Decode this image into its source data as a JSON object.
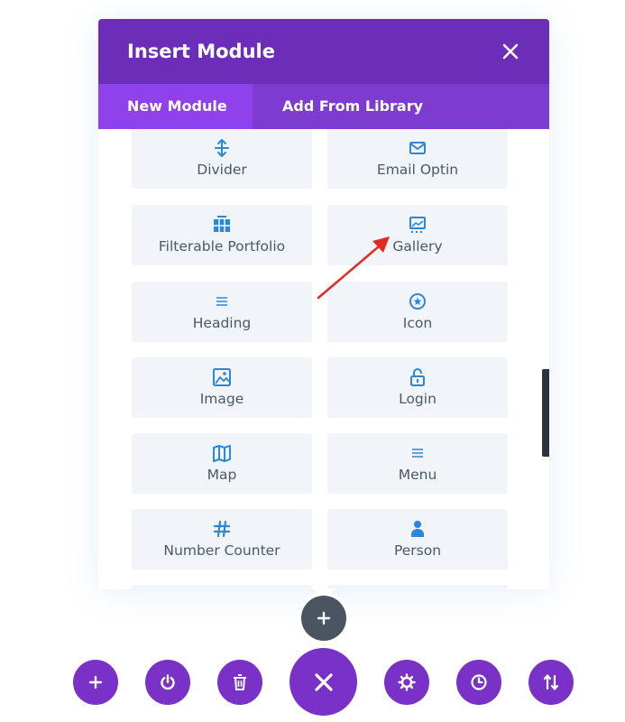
{
  "modal": {
    "title": "Insert Module",
    "tabs": [
      {
        "label": "New Module",
        "active": true
      },
      {
        "label": "Add From Library",
        "active": false
      }
    ]
  },
  "modules": [
    {
      "label": "Divider",
      "icon": "divider-icon"
    },
    {
      "label": "Email Optin",
      "icon": "email-icon"
    },
    {
      "label": "Filterable Portfolio",
      "icon": "portfolio-grid-icon"
    },
    {
      "label": "Gallery",
      "icon": "gallery-icon"
    },
    {
      "label": "Heading",
      "icon": "heading-lines-icon"
    },
    {
      "label": "Icon",
      "icon": "star-circle-icon"
    },
    {
      "label": "Image",
      "icon": "image-icon"
    },
    {
      "label": "Login",
      "icon": "unlock-icon"
    },
    {
      "label": "Map",
      "icon": "map-icon"
    },
    {
      "label": "Menu",
      "icon": "menu-icon"
    },
    {
      "label": "Number Counter",
      "icon": "hash-icon"
    },
    {
      "label": "Person",
      "icon": "person-icon"
    }
  ],
  "colors": {
    "header": "#6c2eb9",
    "tabs_bar": "#7e3bd0",
    "active_tab": "#8f42ec",
    "module_bg": "#f1f5f9",
    "icon": "#2b87da",
    "fab": "#7a31c7",
    "fab_gray": "#4a5561",
    "arrow": "#e02b20"
  },
  "bottom_toolbar": [
    "add-icon",
    "power-icon",
    "trash-icon",
    "close-icon",
    "gear-icon",
    "history-icon",
    "sort-arrows-icon"
  ]
}
